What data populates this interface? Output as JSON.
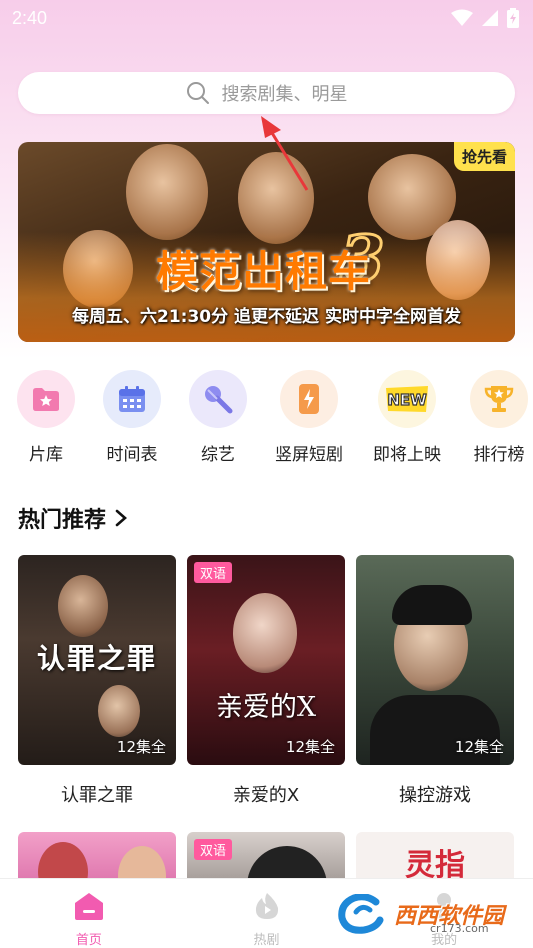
{
  "status_bar": {
    "time": "2:40"
  },
  "search": {
    "placeholder": "搜索剧集、明星"
  },
  "banner": {
    "title": "模范出租车",
    "title_number": "3",
    "subtitle": "每周五、六21:30分 追更不延迟 实时中字全网首发",
    "badge": "抢先看"
  },
  "categories": [
    {
      "label": "片库",
      "icon": "star-folder-icon",
      "bg": "#fde3ef"
    },
    {
      "label": "时间表",
      "icon": "calendar-icon",
      "bg": "#e6ebfb"
    },
    {
      "label": "综艺",
      "icon": "microphone-icon",
      "bg": "#ebe8fb"
    },
    {
      "label": "竖屏短剧",
      "icon": "phone-bolt-icon",
      "bg": "#fdeee2"
    },
    {
      "label": "即将上映",
      "icon": "new-badge-icon",
      "bg": "#fdf6df"
    },
    {
      "label": "排行榜",
      "icon": "trophy-icon",
      "bg": "#fdf0df"
    }
  ],
  "section": {
    "title": "热门推荐"
  },
  "cards": [
    {
      "title": "认罪之罪",
      "episodes": "12集全",
      "poster_text": "认罪之罪"
    },
    {
      "title": "亲爱的X",
      "episodes": "12集全",
      "lang_tag": "双语",
      "poster_text": "亲爱的X"
    },
    {
      "title": "操控游戏",
      "episodes": "12集全"
    }
  ],
  "cards_row2": [
    {
      "lang_tag": ""
    },
    {
      "lang_tag": "双语"
    },
    {
      "poster_text": "灵指"
    }
  ],
  "tabbar": {
    "tabs": [
      {
        "label": "首页",
        "active": true
      },
      {
        "label": "热剧",
        "active": false
      },
      {
        "label": "我的",
        "active": false
      }
    ]
  },
  "watermark": {
    "text": "西西软件园",
    "url": "cr173.com"
  },
  "colors": {
    "accent": "#f25bb0",
    "inactive": "#bdbdbd"
  }
}
